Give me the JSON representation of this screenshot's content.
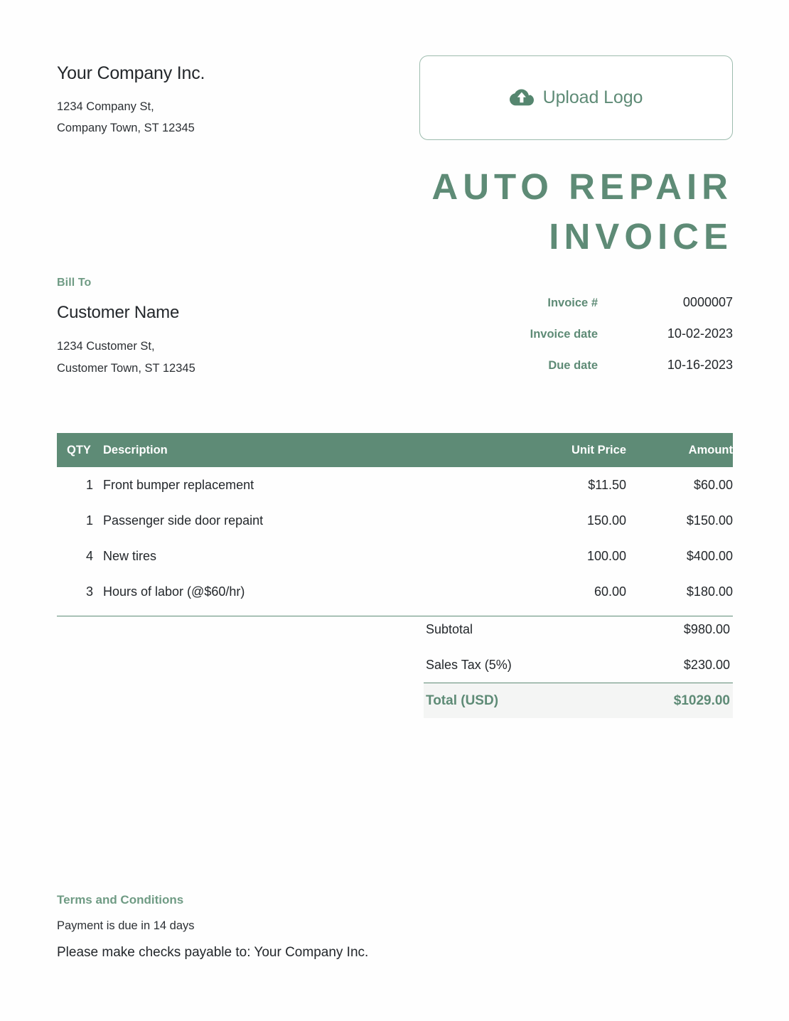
{
  "colors": {
    "accent_green": "#5e8b76",
    "label_green": "#6f9b84",
    "header_bg": "#5e8b76",
    "total_row_bg": "#f4f5f4",
    "page_bg": "#fefefe",
    "text_dark": "#23272b"
  },
  "company": {
    "name": "Your Company Inc.",
    "address": "1234 Company St,\nCompany Town, ST 12345"
  },
  "upload": {
    "label": "Upload Logo",
    "icon": "cloud-upload-icon"
  },
  "title": "AUTO REPAIR INVOICE",
  "bill_to": {
    "label": "Bill To",
    "customer_name": "Customer Name",
    "address": "1234 Customer St,\nCustomer Town, ST 12345"
  },
  "meta": {
    "rows": [
      {
        "key": "Invoice #",
        "value": "0000007"
      },
      {
        "key": "Invoice date",
        "value": "10-02-2023"
      },
      {
        "key": "Due date",
        "value": "10-16-2023"
      }
    ]
  },
  "table": {
    "headers": {
      "qty": "QTY",
      "description": "Description",
      "unit_price": "Unit Price",
      "amount": "Amount"
    },
    "rows": [
      {
        "qty": "1",
        "description": "Front bumper replacement",
        "unit_price": "$11.50",
        "amount": "$60.00"
      },
      {
        "qty": "1",
        "description": "Passenger side door repaint",
        "unit_price": "150.00",
        "amount": "$150.00"
      },
      {
        "qty": "4",
        "description": "New tires",
        "unit_price": "100.00",
        "amount": "$400.00"
      },
      {
        "qty": "3",
        "description": "Hours of labor (@$60/hr)",
        "unit_price": "60.00",
        "amount": "$180.00"
      }
    ]
  },
  "totals": {
    "subtotal_label": "Subtotal",
    "subtotal_value": "$980.00",
    "tax_label": "Sales Tax (5%)",
    "tax_value": "$230.00",
    "total_label": "Total (USD)",
    "total_value": "$1029.00"
  },
  "terms": {
    "title": "Terms and Conditions",
    "line1": "Payment is due in 14 days",
    "line2": "Please make checks payable to: Your Company Inc."
  }
}
